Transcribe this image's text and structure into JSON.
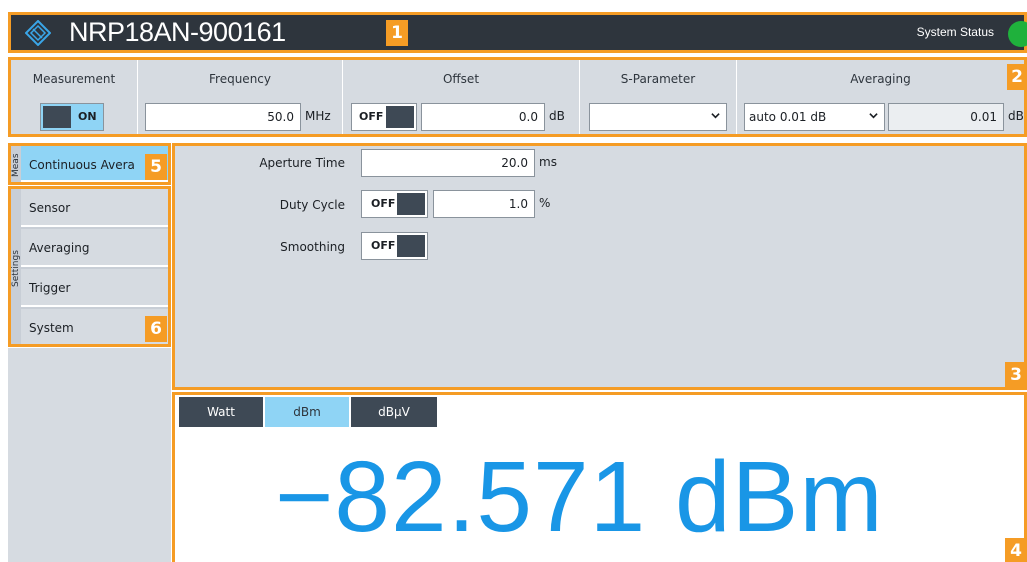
{
  "colors": {
    "accent": "#f59c25",
    "active": "#8fd4f5",
    "reading": "#1996e6",
    "status_ok": "#1fb13c"
  },
  "titlebar": {
    "device_name": "NRP18AN-900161",
    "marker": "1",
    "system_status_label": "System Status",
    "logo_icon": "rs-diamond-logo-icon"
  },
  "params": {
    "marker": "2",
    "measurement": {
      "label": "Measurement",
      "state": "ON"
    },
    "frequency": {
      "label": "Frequency",
      "value": "50.0",
      "unit": "MHz"
    },
    "offset": {
      "label": "Offset",
      "state": "OFF",
      "value": "0.0",
      "unit": "dB"
    },
    "sparameter": {
      "label": "S-Parameter",
      "value": ""
    },
    "averaging": {
      "label": "Averaging",
      "mode": "auto 0.01 dB",
      "value": "0.01",
      "unit": "dB"
    }
  },
  "nav": {
    "meas_label": "Meas",
    "meas_item": "Continuous Avera",
    "meas_marker": "5",
    "settings_label": "Settings",
    "settings_marker": "6",
    "settings_items": [
      "Sensor",
      "Averaging",
      "Trigger",
      "System"
    ]
  },
  "settings_panel": {
    "marker": "3",
    "aperture": {
      "label": "Aperture Time",
      "value": "20.0",
      "unit": "ms"
    },
    "duty_cycle": {
      "label": "Duty Cycle",
      "state": "OFF",
      "value": "1.0",
      "unit": "%"
    },
    "smoothing": {
      "label": "Smoothing",
      "state": "OFF"
    }
  },
  "result": {
    "marker": "4",
    "tabs": [
      "Watt",
      "dBm",
      "dBµV"
    ],
    "active_tab": "dBm",
    "reading": "−82.571 dBm"
  }
}
